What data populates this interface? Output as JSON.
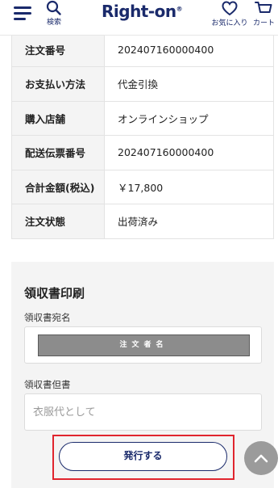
{
  "header": {
    "search_label": "検索",
    "logo_text": "Right-on",
    "logo_mark": "®",
    "favorites_label": "お気に入り",
    "cart_label": "カート"
  },
  "order": {
    "rows": [
      {
        "label": "注文番号",
        "value": "202407160000400"
      },
      {
        "label": "お支払い方法",
        "value": "代金引換"
      },
      {
        "label": "購入店舗",
        "value": "オンラインショップ"
      },
      {
        "label": "配送伝票番号",
        "value": "202407160000400"
      },
      {
        "label": "合計金額(税込)",
        "value": "￥17,800"
      },
      {
        "label": "注文状態",
        "value": "出荷済み"
      }
    ]
  },
  "receipt": {
    "title": "領収書印刷",
    "addressee_label": "領収書宛名",
    "addressee_value": "注文者名",
    "proviso_label": "領収書但書",
    "proviso_placeholder": "衣服代として",
    "issue_button": "発行する"
  },
  "colors": {
    "brand": "#1a2a6b",
    "highlight": "#e0252e",
    "panel_bg": "#f4f4f4"
  }
}
